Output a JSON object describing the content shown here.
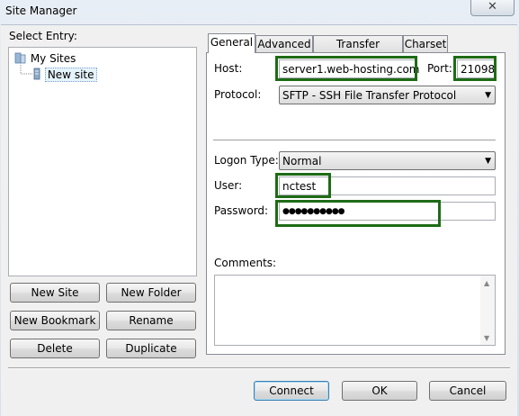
{
  "window": {
    "title": "Site Manager",
    "close_glyph": "✕"
  },
  "entry": {
    "label": "Select Entry:"
  },
  "tree": {
    "root": "My Sites",
    "children": [
      "New site"
    ]
  },
  "left_buttons": {
    "new_site": "New Site",
    "new_folder": "New Folder",
    "new_bookmark": "New Bookmark",
    "rename": "Rename",
    "delete": "Delete",
    "duplicate": "Duplicate"
  },
  "tabs": [
    "General",
    "Advanced",
    "Transfer Settings",
    "Charset"
  ],
  "general": {
    "host_label": "Host:",
    "host_value": "server1.web-hosting.com",
    "port_label": "Port:",
    "port_value": "21098",
    "protocol_label": "Protocol:",
    "protocol_value": "SFTP - SSH File Transfer Protocol",
    "logon_label": "Logon Type:",
    "logon_value": "Normal",
    "user_label": "User:",
    "user_value": "nctest",
    "password_label": "Password:",
    "password_value": "●●●●●●●●●●",
    "comments_label": "Comments:"
  },
  "footer": {
    "connect": "Connect",
    "ok": "OK",
    "cancel": "Cancel"
  },
  "colors": {
    "highlight_box": "#1e6b16",
    "default_button": "#3c7fb1"
  }
}
